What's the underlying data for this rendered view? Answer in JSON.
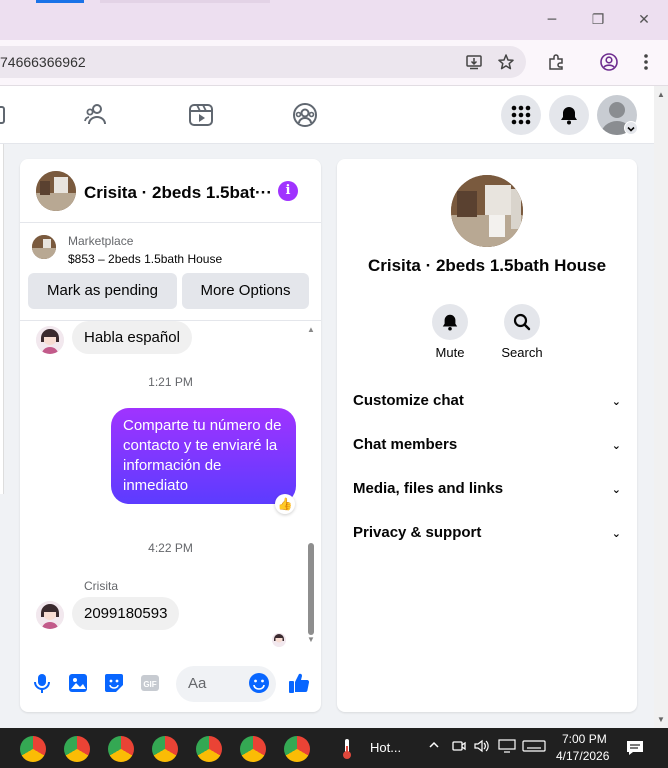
{
  "browser": {
    "url_text": "74666366962",
    "window_controls": {
      "minimize": "─",
      "restore": "❐",
      "close": "✕"
    }
  },
  "chat": {
    "title": "Crisita · 2beds 1.5bat···",
    "info_icon_glyph": "i",
    "marketplace": {
      "label": "Marketplace",
      "listing": "$853 – 2beds 1.5bath House",
      "mark_pending_label": "Mark as pending",
      "more_options_label": "More Options"
    },
    "messages": {
      "incoming_1": "Habla español",
      "time_1": "1:21 PM",
      "outgoing_1_lines": [
        "Comparte tu número de",
        "contacto y te enviaré la",
        "información de",
        "inmediato"
      ],
      "reaction_1": "👍",
      "time_2": "4:22 PM",
      "sender_2": "Crisita",
      "incoming_2": "2099180593"
    },
    "composer": {
      "placeholder": "Aa"
    }
  },
  "info_panel": {
    "name": "Crisita · 2beds 1.5bath House",
    "mute_label": "Mute",
    "search_label": "Search",
    "sections": [
      "Customize chat",
      "Chat members",
      "Media, files and links",
      "Privacy & support"
    ],
    "chevron_glyph": "⌄"
  },
  "taskbar": {
    "weather_label": "Hot...",
    "time": "7:00 PM",
    "date": "4/17/2026"
  },
  "colors": {
    "accent_purple": "#a033ff",
    "bubble_gradient_end": "#5c3cff",
    "fb_blue": "#0866ff"
  }
}
